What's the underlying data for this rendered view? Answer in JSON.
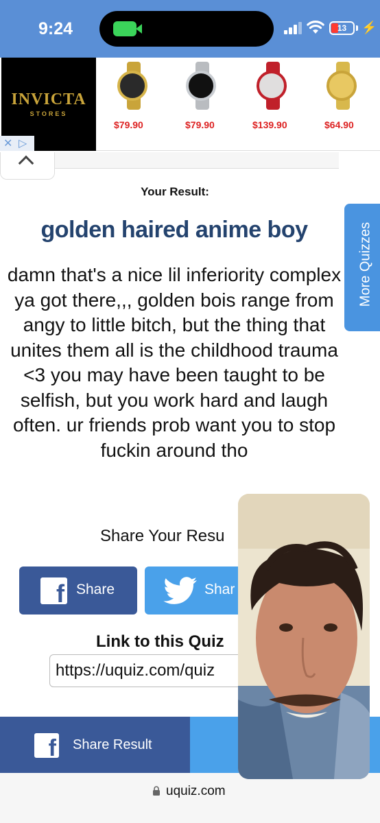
{
  "status_bar": {
    "time": "9:24",
    "battery": "13",
    "accent_color": "#5a8fd6"
  },
  "ad": {
    "brand": "INVICTA",
    "brand_sub": "STORES",
    "prices": [
      "$79.90",
      "$79.90",
      "$139.90",
      "$64.90"
    ]
  },
  "result": {
    "label": "Your Result:",
    "title": "golden haired anime boy",
    "description": "damn that's a nice lil inferiority complex ya got there,,, golden bois range from angy to little bitch, but the thing that unites them all is the childhood trauma <3 you may have been taught to be selfish, but you work hard and laugh often. ur friends prob want you to stop fuckin around tho",
    "title_color": "#24436e"
  },
  "sidebar": {
    "more_quizzes": "More Quizzes"
  },
  "share": {
    "heading": "Share Your Resu",
    "facebook_label": "Share",
    "twitter_label": "Shar",
    "facebook_color": "#3a5998",
    "twitter_color": "#4aa1ea"
  },
  "link": {
    "heading": "Link to this Quiz",
    "value": "https://uquiz.com/quiz"
  },
  "bottom_share": {
    "facebook_label": "Share Result"
  },
  "browser": {
    "url": "uquiz.com"
  },
  "icons": [
    "video-icon",
    "signal-icon",
    "wifi-icon",
    "battery-icon",
    "bolt-icon",
    "chevron-up-icon",
    "facebook-icon",
    "twitter-icon",
    "lock-icon",
    "ad-close-icon",
    "ad-info-icon"
  ]
}
